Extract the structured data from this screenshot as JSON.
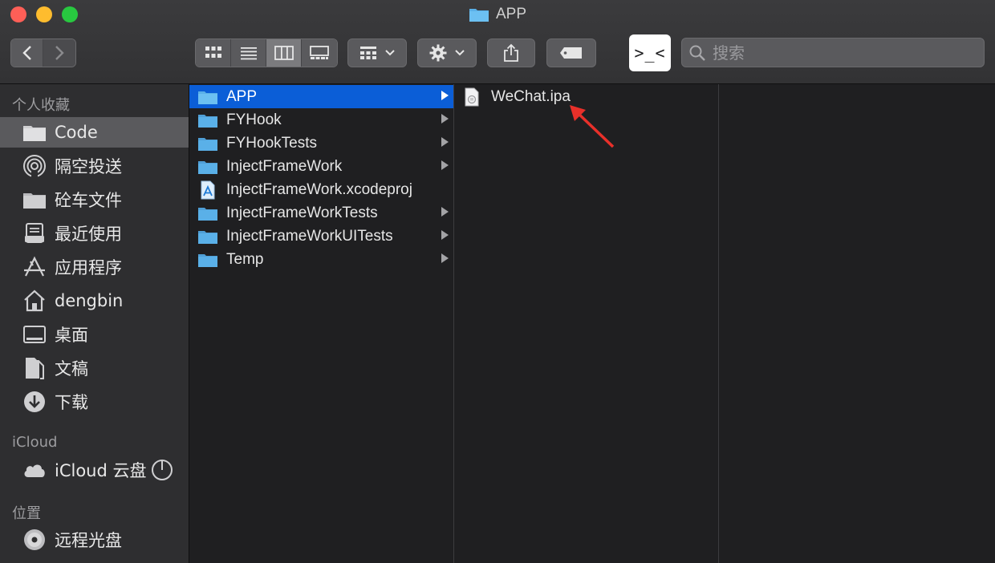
{
  "window": {
    "title": "APP"
  },
  "toolbar": {
    "search_placeholder": "搜索",
    "terminal_label": ">_<",
    "view_modes": [
      "icon",
      "list",
      "column",
      "gallery"
    ],
    "active_view": "column"
  },
  "sidebar": {
    "favorites_header": "个人收藏",
    "favorites": [
      {
        "label": "Code",
        "icon": "folder-icon",
        "selected": true
      },
      {
        "label": "隔空投送",
        "icon": "airdrop-icon"
      },
      {
        "label": "砼车文件",
        "icon": "folder-icon"
      },
      {
        "label": "最近使用",
        "icon": "recents-icon"
      },
      {
        "label": "应用程序",
        "icon": "applications-icon"
      },
      {
        "label": "dengbin",
        "icon": "home-icon"
      },
      {
        "label": "桌面",
        "icon": "desktop-icon"
      },
      {
        "label": "文稿",
        "icon": "documents-icon"
      },
      {
        "label": "下载",
        "icon": "downloads-icon"
      }
    ],
    "icloud_header": "iCloud",
    "icloud": [
      {
        "label": "iCloud 云盘",
        "icon": "cloud-icon"
      }
    ],
    "locations_header": "位置",
    "locations": [
      {
        "label": "远程光盘",
        "icon": "disc-icon"
      }
    ]
  },
  "columns": {
    "col1": [
      {
        "name": "APP",
        "type": "folder",
        "selected": true,
        "has_children": true
      },
      {
        "name": "FYHook",
        "type": "folder",
        "has_children": true
      },
      {
        "name": "FYHookTests",
        "type": "folder",
        "has_children": true
      },
      {
        "name": "InjectFrameWork",
        "type": "folder",
        "has_children": true
      },
      {
        "name": "InjectFrameWork.xcodeproj",
        "type": "xcodeproj",
        "has_children": false
      },
      {
        "name": "InjectFrameWorkTests",
        "type": "folder",
        "has_children": true
      },
      {
        "name": "InjectFrameWorkUITests",
        "type": "folder",
        "has_children": true
      },
      {
        "name": "Temp",
        "type": "folder",
        "has_children": true
      }
    ],
    "col2": [
      {
        "name": "WeChat.ipa",
        "type": "ipa",
        "has_children": false
      }
    ]
  },
  "colors": {
    "selection": "#0b5ed7",
    "folder": "#5ab0e8",
    "annotation_arrow": "#e8302a"
  }
}
